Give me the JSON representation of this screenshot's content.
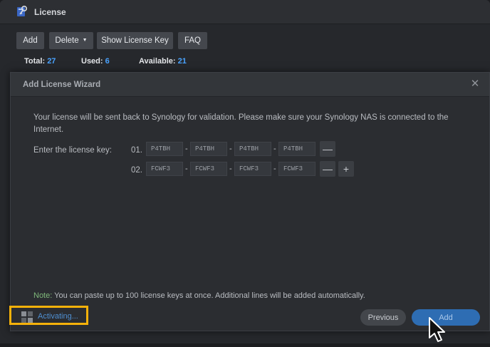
{
  "window": {
    "title": "License",
    "icon": "license-key-icon"
  },
  "toolbar": {
    "add_label": "Add",
    "delete_label": "Delete",
    "delete_caret": "▼",
    "show_key_label": "Show License Key",
    "faq_label": "FAQ"
  },
  "stats": {
    "total_label": "Total:",
    "total_value": "27",
    "used_label": "Used:",
    "used_value": "6",
    "available_label": "Available:",
    "available_value": "21"
  },
  "wizard": {
    "title": "Add License Wizard",
    "close_glyph": "✕",
    "message": "Your license will be sent back to Synology for validation. Please make sure your Synology NAS is connected to the Internet.",
    "key_label": "Enter the license key:",
    "rows": [
      {
        "num": "01.",
        "keys": [
          "P4TBH",
          "P4TBH",
          "P4TBH",
          "P4TBH"
        ]
      },
      {
        "num": "02.",
        "keys": [
          "FCWF3",
          "FCWF3",
          "FCWF3",
          "FCWF3"
        ]
      }
    ],
    "separator": "-",
    "remove_glyph": "—",
    "add_row_glyph": "+",
    "note_label": "Note:",
    "note_text": " You can paste up to 100 license keys at once. Additional lines will be added automatically.",
    "status_text": "Activating...",
    "previous_label": "Previous",
    "add_label": "Add"
  },
  "colors": {
    "accent": "#4aa3ff",
    "primary_button": "#2e6db3",
    "highlight_box": "#f5b10a",
    "note_label": "#7fb87a"
  }
}
